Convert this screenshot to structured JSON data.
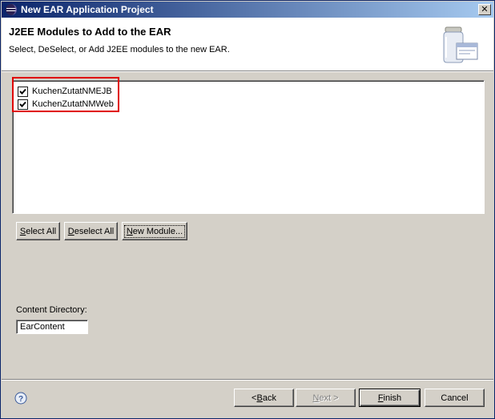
{
  "window": {
    "title": "New EAR Application Project"
  },
  "header": {
    "title": "J2EE Modules to Add to the EAR",
    "description": "Select, DeSelect, or Add J2EE modules to the new EAR."
  },
  "modules": [
    {
      "label": "KuchenZutatNMEJB",
      "checked": true
    },
    {
      "label": "KuchenZutatNMWeb",
      "checked": true
    }
  ],
  "module_buttons": {
    "select_all": {
      "pre": "",
      "mnemonic": "S",
      "post": "elect All"
    },
    "deselect_all": {
      "pre": "",
      "mnemonic": "D",
      "post": "eselect All"
    },
    "new_module": {
      "pre": "",
      "mnemonic": "N",
      "post": "ew Module..."
    }
  },
  "content_directory": {
    "label": "Content Directory:",
    "value": "EarContent"
  },
  "nav_buttons": {
    "back": {
      "pre": "< ",
      "mnemonic": "B",
      "post": "ack"
    },
    "next": {
      "pre": "",
      "mnemonic": "N",
      "post": "ext >"
    },
    "finish": {
      "pre": "",
      "mnemonic": "F",
      "post": "inish"
    },
    "cancel": {
      "label": "Cancel"
    }
  },
  "colors": {
    "titlebar_start": "#0a246a",
    "titlebar_end": "#a6caf0",
    "highlight": "#e00000",
    "dialog_bg": "#d4d0c8"
  },
  "icons": {
    "title": "eclipse-icon",
    "header": "jar-wizard-icon",
    "help": "help-icon"
  }
}
